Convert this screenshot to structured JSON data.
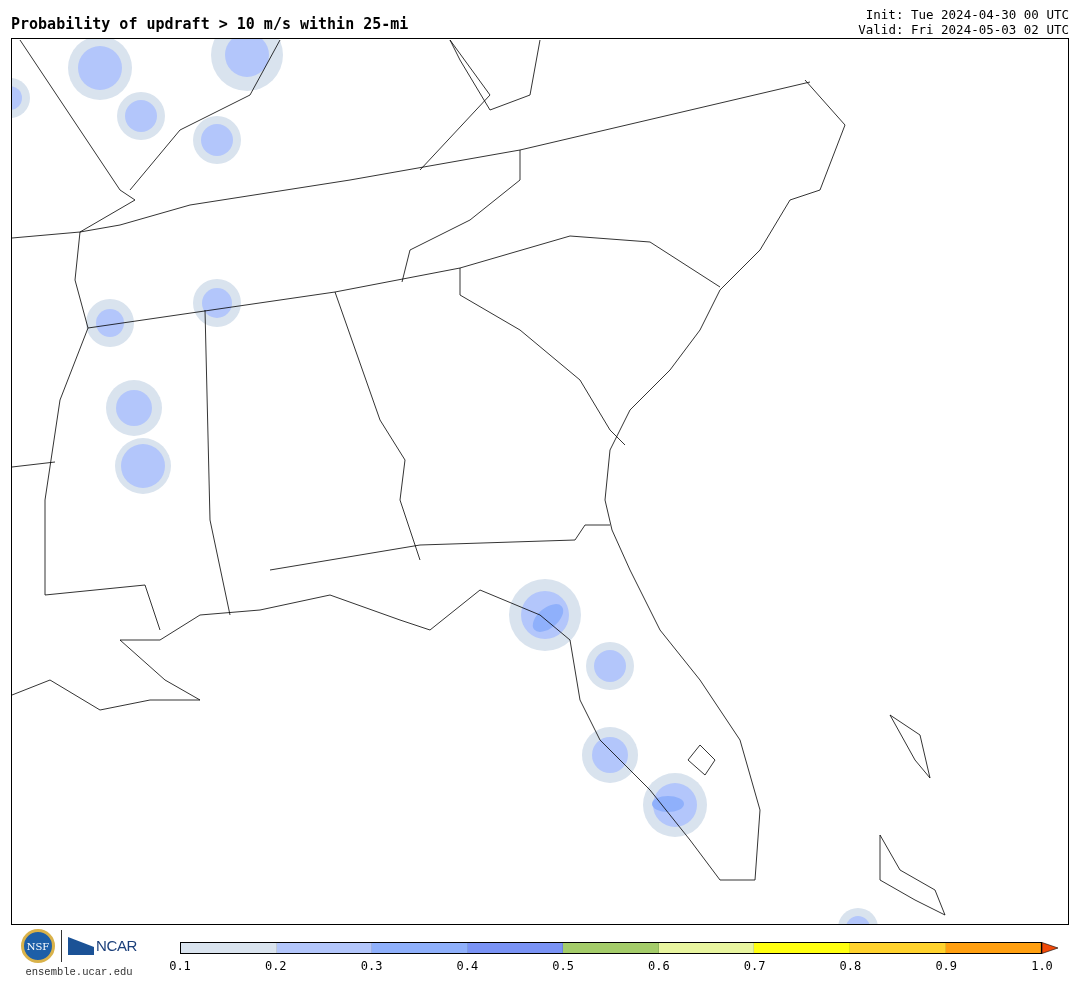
{
  "title": "Probability of updraft > 10 m/s within 25-mi",
  "init": "Init: Tue 2024-04-30 00 UTC",
  "valid": "Valid: Fri 2024-05-03 02 UTC",
  "logos": {
    "nsf": "NSF",
    "ncar": "NCAR",
    "site": "ensemble.ucar.edu"
  },
  "colorbar": {
    "bins": [
      {
        "color": "#d9e3ee"
      },
      {
        "color": "#b3c6fb"
      },
      {
        "color": "#8fb0fb"
      },
      {
        "color": "#7a93f5"
      },
      {
        "color": "#a4cc6a"
      },
      {
        "color": "#e8f5a0"
      },
      {
        "color": "#ffff10"
      },
      {
        "color": "#ffd22d"
      },
      {
        "color": "#ff9f10"
      }
    ],
    "extension": {
      "color": "#f04a0a"
    },
    "ticks": [
      "0.1",
      "0.2",
      "0.3",
      "0.4",
      "0.5",
      "0.6",
      "0.7",
      "0.8",
      "0.9",
      "1.0"
    ]
  }
}
